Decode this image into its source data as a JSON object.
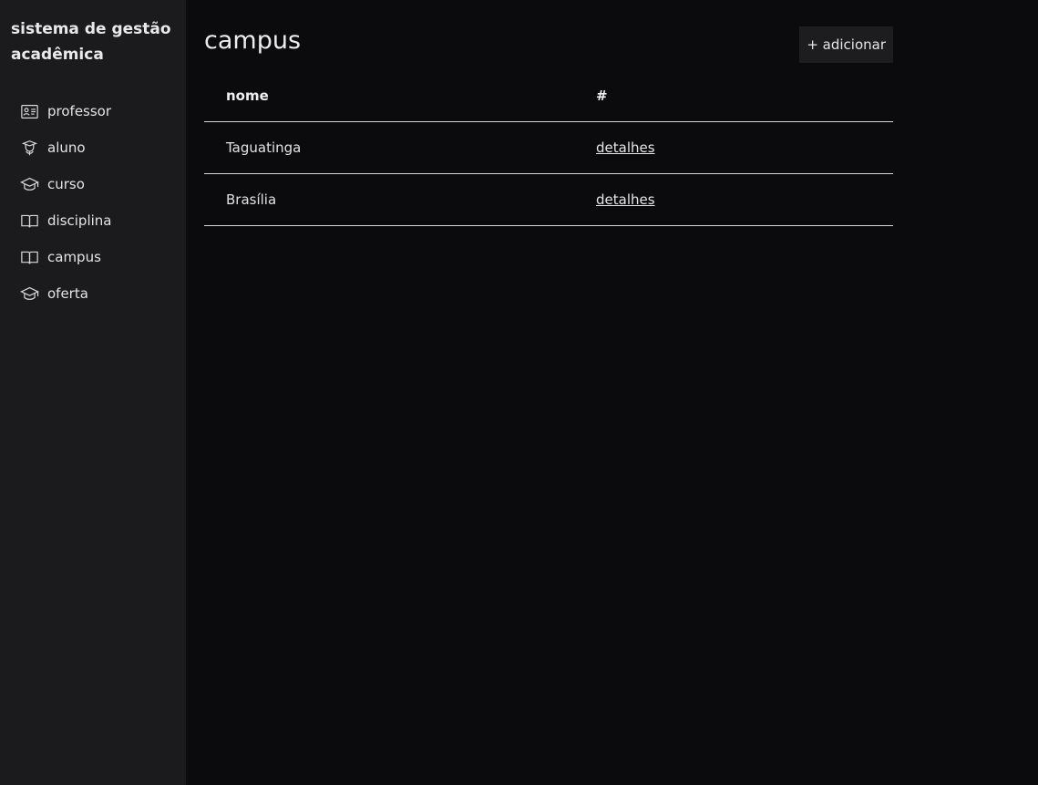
{
  "sidebar": {
    "brand": "sistema de gestão acadêmica",
    "items": [
      {
        "label": "professor",
        "icon": "id-card-icon"
      },
      {
        "label": "aluno",
        "icon": "student-icon"
      },
      {
        "label": "curso",
        "icon": "graduation-cap-icon"
      },
      {
        "label": "disciplina",
        "icon": "book-open-icon"
      },
      {
        "label": "campus",
        "icon": "book-open-icon"
      },
      {
        "label": "oferta",
        "icon": "graduation-cap-icon"
      }
    ]
  },
  "main": {
    "title": "campus",
    "add_label": "+ adicionar",
    "table": {
      "headers": [
        "nome",
        "#"
      ],
      "rows": [
        {
          "nome": "Taguatinga",
          "link": "detalhes"
        },
        {
          "nome": "Brasília",
          "link": "detalhes"
        }
      ]
    }
  }
}
